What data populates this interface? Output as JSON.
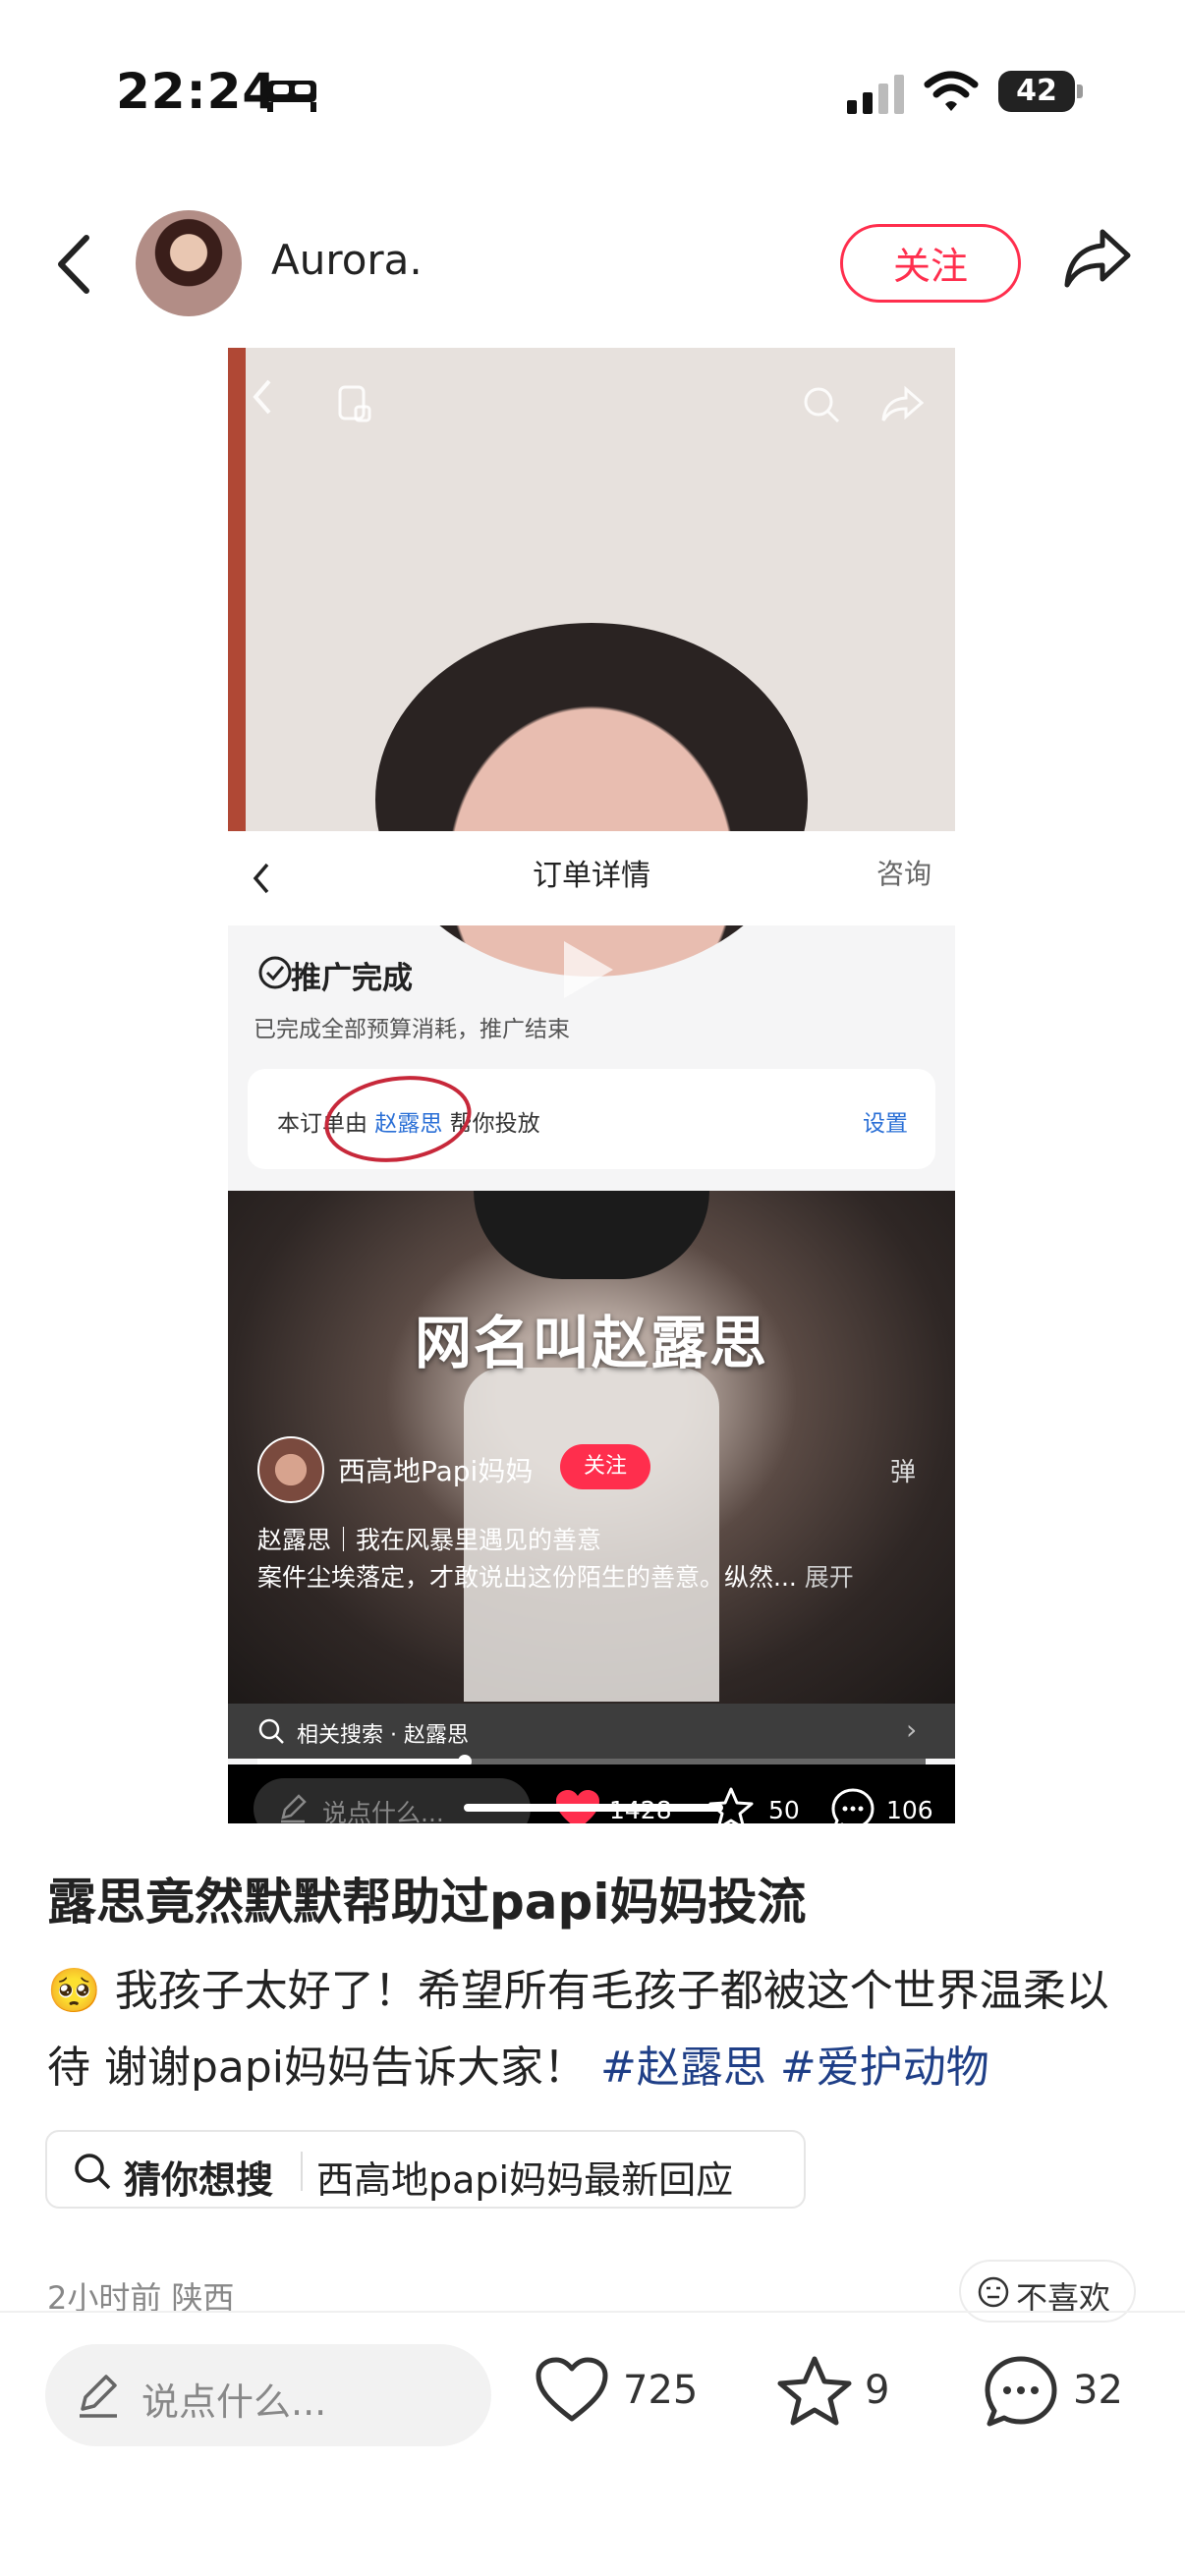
{
  "status_bar": {
    "time": "22:24",
    "battery": "42"
  },
  "header": {
    "username": "Aurora.",
    "follow_label": "关注"
  },
  "media": {
    "order_title": "订单详情",
    "order_consult": "咨询",
    "promo_title": "推广完成",
    "promo_subtitle": "已完成全部预算消耗，推广结束",
    "order_card_prefix": "本订单由",
    "order_card_link": "赵露思",
    "order_card_suffix": "帮你投放",
    "order_card_setting": "设置",
    "video_title": "网名叫赵露思",
    "video_author": "西高地Papi妈妈",
    "video_follow": "关注",
    "video_danmu": "弹",
    "video_line1": "赵露思｜我在风暴里遇见的善意",
    "video_line2": "案件尘埃落定，才敢说出这份陌生的善意。纵然...",
    "video_more": "展开",
    "related_search": "相关搜索 · 赵露思",
    "video_input_placeholder": "说点什么...",
    "video_likes": "1428",
    "video_stars": "50",
    "video_comments": "106",
    "progress": 0.31
  },
  "post": {
    "title": "露思竟然默默帮助过papi妈妈投流",
    "emoji": "🥺",
    "body": "我孩子太好了！希望所有毛孩子都被这个世界温柔以待 谢谢papi妈妈告诉大家！",
    "tags": [
      "#赵露思",
      "#爱护动物"
    ],
    "guess_label": "猜你想搜",
    "guess_text": "西高地papi妈妈最新回应",
    "time_location": "2小时前 陕西",
    "dislike_label": "不喜欢"
  },
  "bottom_bar": {
    "comment_placeholder": "说点什么...",
    "likes": "725",
    "stars": "9",
    "comments": "32"
  },
  "colors": {
    "accent": "#ff2e4d",
    "tag": "#1f3f87",
    "link": "#2a6fd6"
  }
}
